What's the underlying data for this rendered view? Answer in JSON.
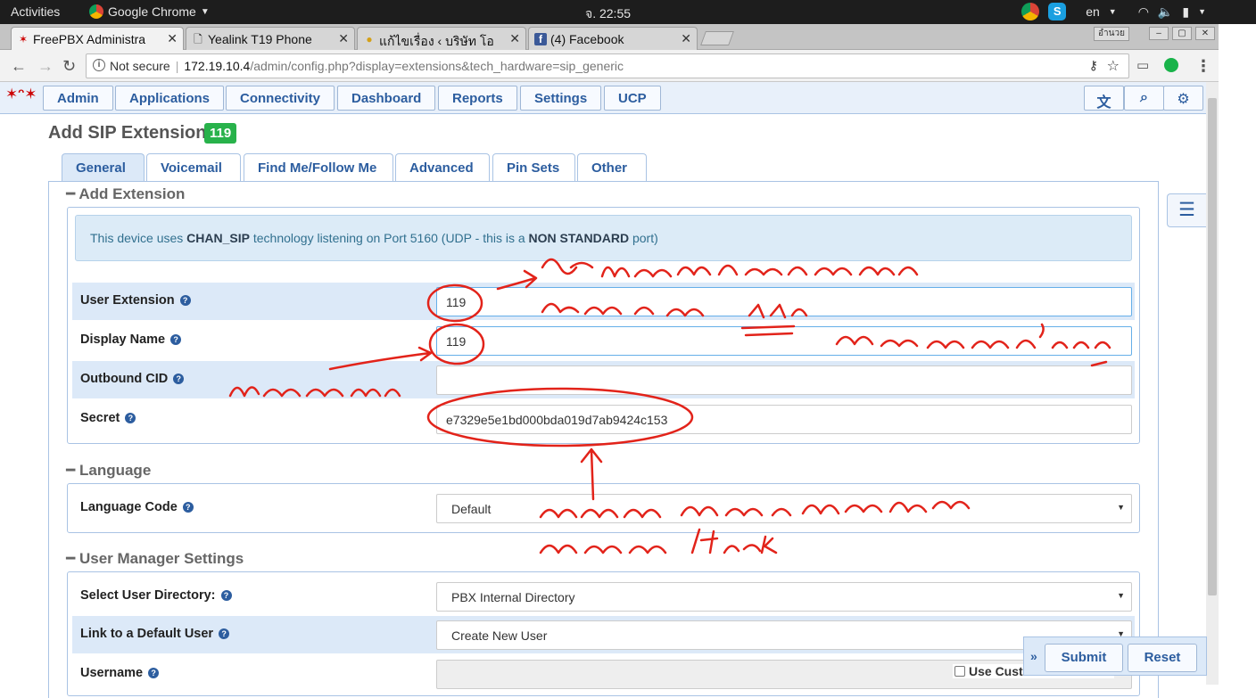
{
  "gnome": {
    "activities": "Activities",
    "app_menu": "Google Chrome",
    "clock": "จ. 22:55",
    "lang": "en"
  },
  "chrome": {
    "tabs": [
      {
        "label": "FreePBX Administra",
        "active": true
      },
      {
        "label": "Yealink T19 Phone",
        "active": false
      },
      {
        "label": "แก้ไขเรื่อง ‹ บริษัท โอ",
        "active": false
      },
      {
        "label": "(4) Facebook",
        "active": false
      }
    ],
    "profile_label": "อำนวย",
    "security_label": "Not secure",
    "url_host": "172.19.10.4",
    "url_path": "/admin/config.php?display=extensions&tech_hardware=sip_generic"
  },
  "fpbx_nav": {
    "items": [
      "Admin",
      "Applications",
      "Connectivity",
      "Dashboard",
      "Reports",
      "Settings",
      "UCP"
    ]
  },
  "page": {
    "title": "Add SIP Extension",
    "ext_badge": "119",
    "tabs": [
      "General",
      "Voicemail",
      "Find Me/Follow Me",
      "Advanced",
      "Pin Sets",
      "Other"
    ],
    "active_tab": "General"
  },
  "add_extension": {
    "heading": "Add Extension",
    "info_pre": "This device uses",
    "info_tech": "CHAN_SIP",
    "info_mid": "technology listening on Port 5160 (UDP - this is a",
    "info_std": "NON STANDARD",
    "info_post": "port)",
    "fields": [
      {
        "label": "User Extension",
        "value": ""
      },
      {
        "label": "Display Name",
        "value": ""
      },
      {
        "label": "Outbound CID",
        "value": ""
      },
      {
        "label": "Secret",
        "value": "e7329e5e1bd000bda019d7ab9424c153"
      }
    ],
    "user_extension_value": "119",
    "display_name_value": "119"
  },
  "language": {
    "heading": "Language",
    "label": "Language Code",
    "value": "Default"
  },
  "user_manager": {
    "heading": "User Manager Settings",
    "directory_label": "Select User Directory:",
    "directory_value": "PBX Internal Directory",
    "default_user_label": "Link to a Default User",
    "default_user_value": "Create New User",
    "username_label": "Username",
    "custom_username_label": "Use Custom Username"
  },
  "actions": {
    "submit": "Submit",
    "reset": "Reset"
  },
  "annotation_colors": {
    "ink": "#e2231a"
  }
}
